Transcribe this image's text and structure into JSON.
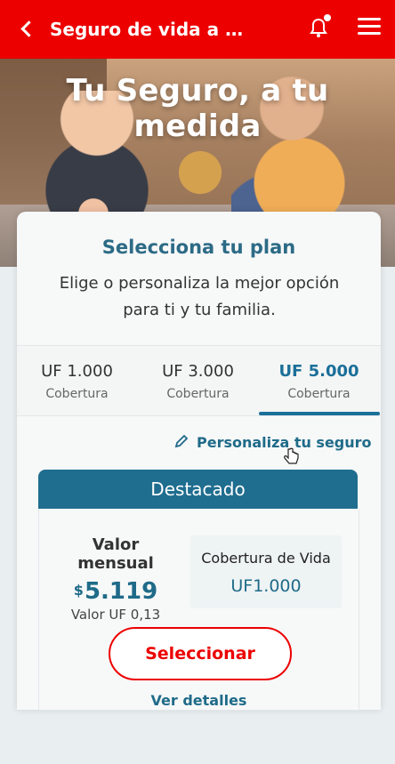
{
  "header": {
    "title": "Seguro de vida a tu ...",
    "icons": {
      "back": "back-arrow-icon",
      "notifications": "bell-icon",
      "menu": "hamburger-menu-icon"
    },
    "color": "#ec0000"
  },
  "hero": {
    "title": "Tu Seguro, a tu medida"
  },
  "card": {
    "title": "Selecciona tu plan",
    "subtitle": "Elige o personaliza la mejor opción para ti y tu familia.",
    "tabs": [
      {
        "amount": "UF 1.000",
        "label": "Cobertura"
      },
      {
        "amount": "UF 3.000",
        "label": "Cobertura"
      },
      {
        "amount": "UF 5.000",
        "label": "Cobertura",
        "selected": true
      }
    ],
    "personaliza_label": "Personaliza tu seguro",
    "destacado_label": "Destacado",
    "plan": {
      "valor_label": "Valor mensual",
      "currency": "$",
      "price": "5.119",
      "valor_uf": "Valor UF 0,13",
      "cobertura_label": "Cobertura de Vida",
      "cobertura_value": "UF1.000"
    },
    "seleccionar_label": "Seleccionar",
    "ver_detalles_label": "Ver detalles"
  },
  "colors": {
    "brand_red": "#ec0000",
    "accent_blue": "#1f6d8f"
  }
}
